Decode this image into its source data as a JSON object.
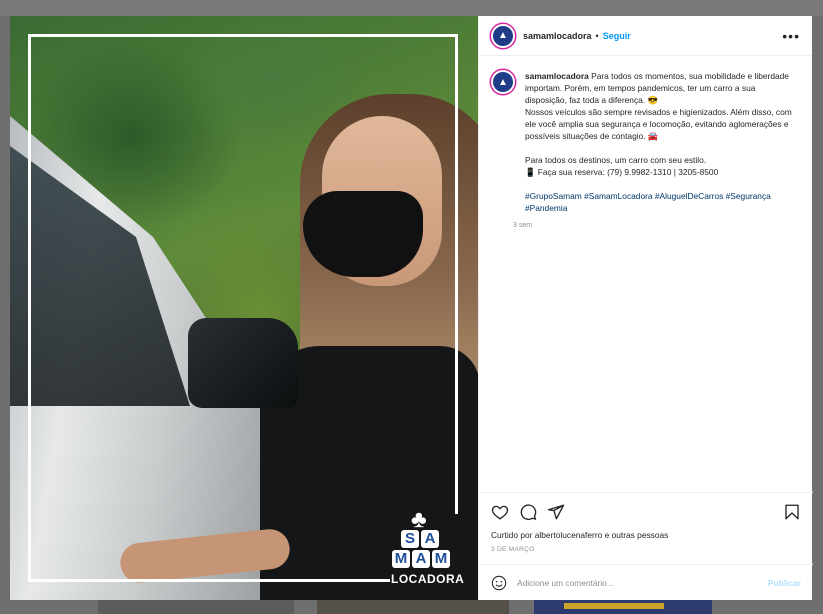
{
  "post": {
    "username": "samamlocadora",
    "separator": "•",
    "follow_label": "Seguir",
    "more_label": "•••",
    "caption_lines": [
      "Para todos os momentos, sua mobilidade e liberdade importam. Porém, em tempos pandemicos, ter um carro a sua disposição, faz toda a diferença. 😎",
      "Nossos veículos são sempre revisados e higienizados. Além disso, com ele você amplia sua segurança e locomoção, evitando aglomerações e possíveis situações de contagio. 🚘",
      "Para todos os destinos, um carro com seu estilo.",
      "📱 Faça sua reserva: (79) 9.9982-1310 | 3205-8500"
    ],
    "hashtags": "#GrupoSamam #SamamLocadora #AluguelDeCarros #Segurança #Pandemia",
    "caption_time": "3 sem",
    "likes_text": "Curtido por albertolucenaferro e outras pessoas",
    "date": "3 DE MARÇO",
    "comment_placeholder": "Adicione um comentário...",
    "publish_label": "Publicar"
  },
  "logo": {
    "row1": [
      "S",
      "A"
    ],
    "row2": [
      "M",
      "A",
      "M"
    ],
    "brand": "LOCADORA"
  },
  "icons": {
    "like": "heart-icon",
    "comment": "comment-icon",
    "share": "send-icon",
    "save": "bookmark-icon",
    "emoji": "emoji-icon"
  },
  "colors": {
    "link": "#0095f6",
    "hashtag": "#00376b",
    "brand_blue": "#1f3c88"
  }
}
